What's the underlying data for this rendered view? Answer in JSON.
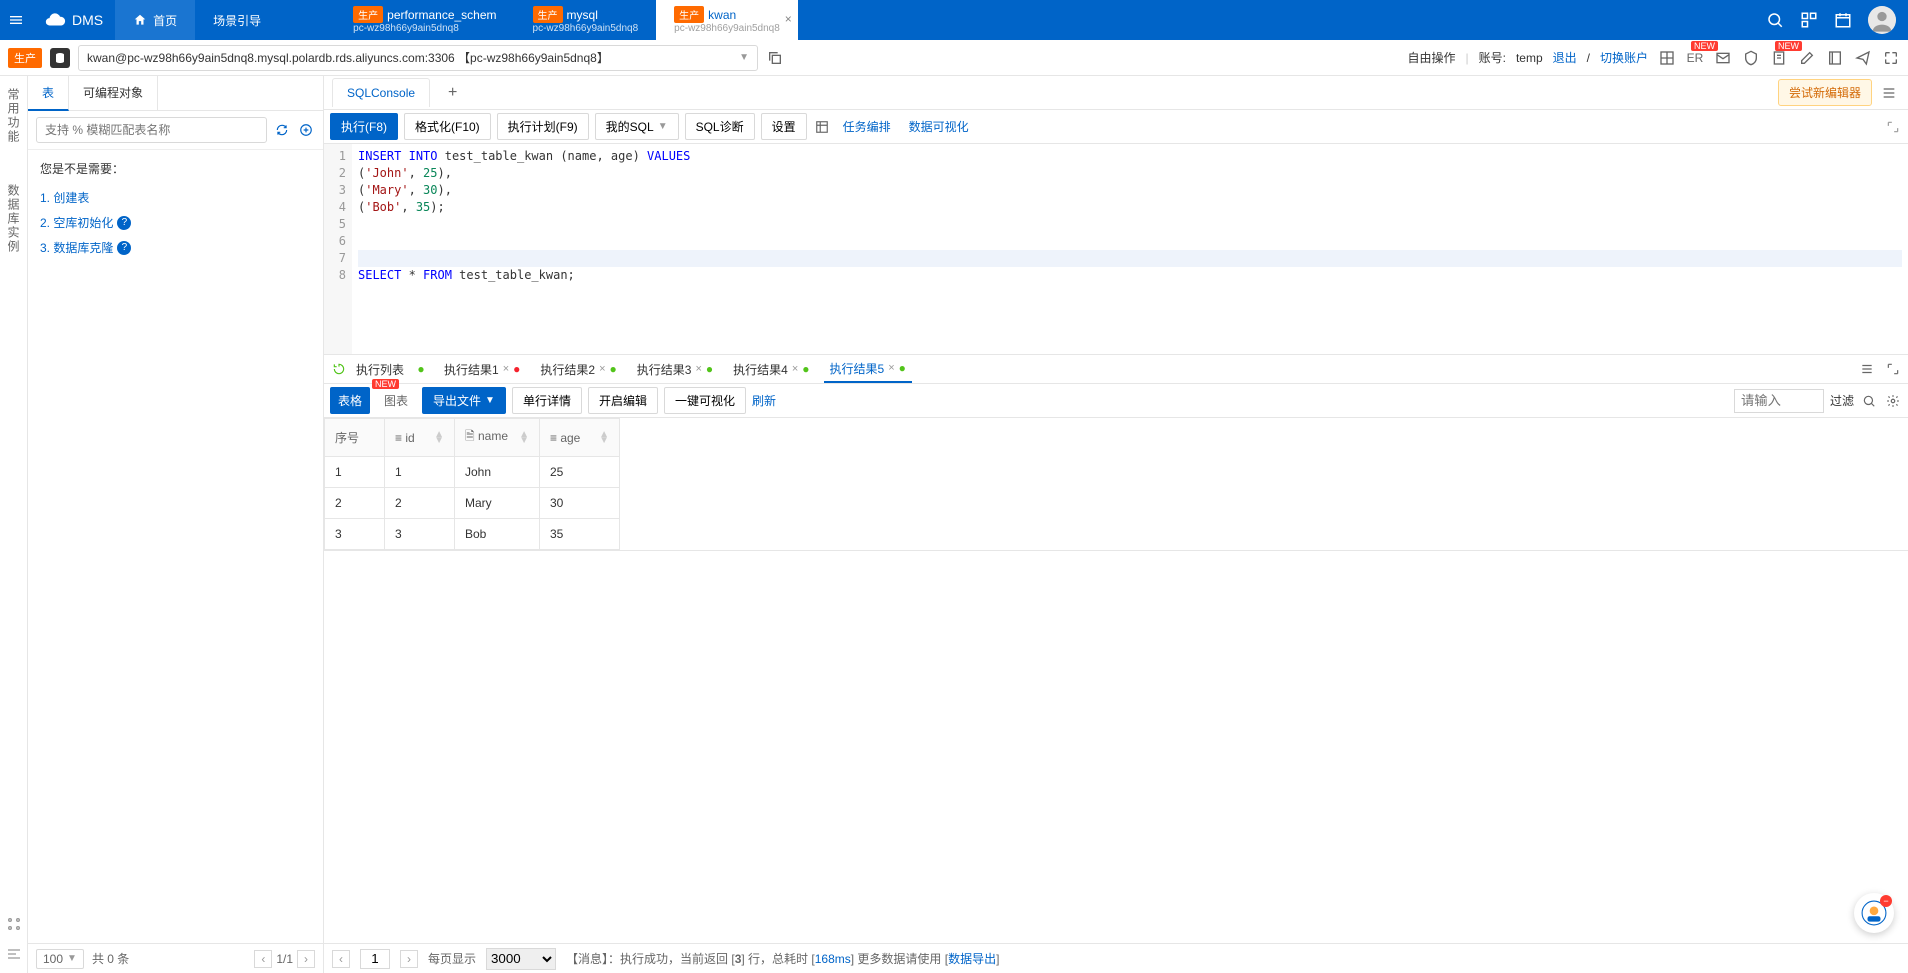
{
  "header": {
    "product": "DMS",
    "tabs": [
      {
        "type": "home",
        "label": "首页"
      },
      {
        "type": "plain",
        "label": "场景引导"
      },
      {
        "type": "db",
        "tag": "生产",
        "title": "performance_schem",
        "sub": "pc-wz98h66y9ain5dnq8"
      },
      {
        "type": "db",
        "tag": "生产",
        "title": "mysql",
        "sub": "pc-wz98h66y9ain5dnq8"
      },
      {
        "type": "db",
        "tag": "生产",
        "title": "kwan",
        "sub": "pc-wz98h66y9ain5dnq8",
        "active": true
      }
    ]
  },
  "conn": {
    "badge": "生产",
    "text": "kwan@pc-wz98h66y9ain5dnq8.mysql.polardb.rds.aliyuncs.com:3306 【pc-wz98h66y9ain5dnq8】",
    "free_op": "自由操作",
    "account_label": "账号:",
    "account": "temp",
    "logout": "退出",
    "switch": "切换账户",
    "er": "ER",
    "new": "NEW"
  },
  "rail": {
    "items": [
      "常用功能",
      "数据库实例"
    ]
  },
  "side": {
    "tabs": [
      "表",
      "可编程对象"
    ],
    "search_placeholder": "支持 % 模糊匹配表名称",
    "hint": "您是不是需要：",
    "links": [
      "1. 创建表",
      "2. 空库初始化",
      "3. 数据库克隆"
    ],
    "page_size": "100",
    "total": "共 0 条",
    "page": "1/1"
  },
  "doc_tabs": {
    "main": "SQLConsole",
    "try_new": "尝试新编辑器"
  },
  "toolbar": {
    "execute": "执行(F8)",
    "format": "格式化(F10)",
    "plan": "执行计划(F9)",
    "mysql": "我的SQL",
    "diag": "SQL诊断",
    "settings": "设置",
    "task": "任务编排",
    "viz": "数据可视化"
  },
  "sql_lines": [
    {
      "n": 1,
      "html": "<span class='kw'>INSERT</span> <span class='kw'>INTO</span> test_table_kwan (name, age) <span class='kw'>VALUES</span>"
    },
    {
      "n": 2,
      "html": "(<span class='str'>'John'</span>, <span class='num'>25</span>),"
    },
    {
      "n": 3,
      "html": "(<span class='str'>'Mary'</span>, <span class='num'>30</span>),"
    },
    {
      "n": 4,
      "html": "(<span class='str'>'Bob'</span>, <span class='num'>35</span>);"
    },
    {
      "n": 5,
      "html": ""
    },
    {
      "n": 6,
      "html": ""
    },
    {
      "n": 7,
      "html": "",
      "hl": true
    },
    {
      "n": 8,
      "html": "<span class='kw'>SELECT</span> * <span class='kw'>FROM</span> test_table_kwan;"
    }
  ],
  "res_tabs": {
    "list": "执行列表",
    "items": [
      {
        "label": "执行结果1",
        "status": "fail"
      },
      {
        "label": "执行结果2",
        "status": "ok"
      },
      {
        "label": "执行结果3",
        "status": "ok"
      },
      {
        "label": "执行结果4",
        "status": "ok"
      },
      {
        "label": "执行结果5",
        "status": "ok",
        "active": true
      }
    ]
  },
  "res_tools": {
    "grid_tab": "表格",
    "chart_tab": "图表",
    "new": "NEW",
    "export": "导出文件",
    "row_detail": "单行详情",
    "edit": "开启编辑",
    "oneclick": "一键可视化",
    "refresh": "刷新",
    "input_placeholder": "请输入",
    "filter": "过滤"
  },
  "grid": {
    "headers": [
      "序号",
      "id",
      "name",
      "age"
    ],
    "rows": [
      [
        "1",
        "1",
        "John",
        "25"
      ],
      [
        "2",
        "2",
        "Mary",
        "30"
      ],
      [
        "3",
        "3",
        "Bob",
        "35"
      ]
    ]
  },
  "status": {
    "page": "1",
    "per_page_label": "每页显示",
    "per_page": "3000",
    "msg_prefix": "【消息】：执行成功，当前返回 [",
    "rows": "3",
    "msg_mid": "] 行，总耗时 [",
    "time": "168ms",
    "msg_suffix": "] 更多数据请使用 [",
    "export": "数据导出",
    "msg_end": "]"
  }
}
